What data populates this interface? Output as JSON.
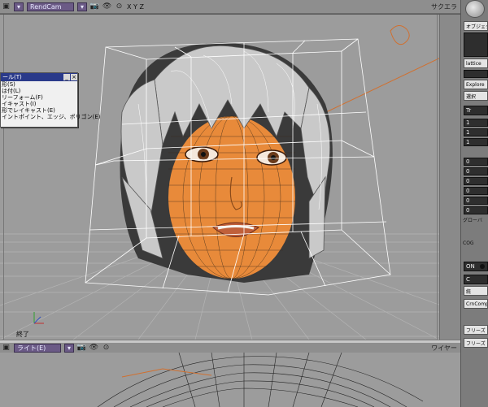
{
  "top_toolbar": {
    "view_dropdown": "RendCam",
    "axes": "X Y Z",
    "right_label": "サクエラ"
  },
  "bottom_toolbar": {
    "view_dropdown": "ライト(E)",
    "right_label": "ワイヤー"
  },
  "context_menu": {
    "title": "ール(T)",
    "items": [
      "形(S)",
      "は付(L)",
      "リーフォーム(F)",
      "イキャスト(I)",
      "形でレイキャスト(E)",
      "イントポイント、エッジ、ポリゴン(E)"
    ]
  },
  "status_text": "終了",
  "right_panel": {
    "object_btn": "オブジェクト",
    "lattice_field": "lattice",
    "tr_header": "Tr",
    "explore_btn": "Explore",
    "select_btn": "選択",
    "values": [
      "1",
      "1",
      "1",
      "0",
      "0",
      "0",
      "0",
      "0",
      "0"
    ],
    "global_label": "グローバ",
    "cog_label": "COG",
    "on_btn": "ON",
    "c_header": "C",
    "btn_c2": "統",
    "crncomp_btn": "CrnComp",
    "freeze_btn": "フリーズ",
    "freeze_m_btn": "フリーズ M"
  },
  "colors": {
    "skin": "#e88a3a",
    "wire": "#ffffff",
    "menu_title": "#2a3a8a",
    "toolbar_btn": "#6b5a86"
  }
}
